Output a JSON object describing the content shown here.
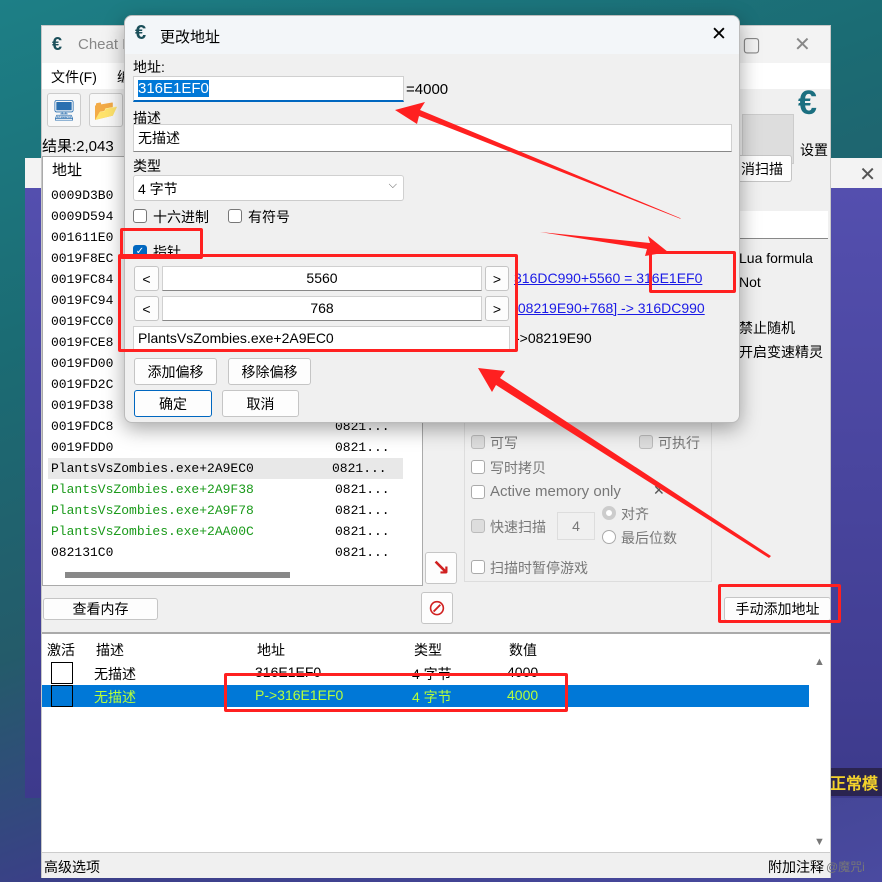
{
  "game_window": {
    "banner": "长正常模"
  },
  "main_window": {
    "title": "Cheat E",
    "menu": [
      "文件(F)",
      "编"
    ],
    "results_label": "结果:2,043",
    "settings_label": "设置",
    "cancel_scan_label": "消扫描",
    "list": {
      "header": "地址",
      "rows": [
        {
          "address": "0009D3B0",
          "value": ""
        },
        {
          "address": "0009D594",
          "value": ""
        },
        {
          "address": "001611E0",
          "value": ""
        },
        {
          "address": "0019F8EC",
          "value": ""
        },
        {
          "address": "0019FC84",
          "value": ""
        },
        {
          "address": "0019FC94",
          "value": ""
        },
        {
          "address": "0019FCC0",
          "value": ""
        },
        {
          "address": "0019FCE8",
          "value": ""
        },
        {
          "address": "0019FD00",
          "value": ""
        },
        {
          "address": "0019FD2C",
          "value": ""
        },
        {
          "address": "0019FD38",
          "value": ""
        },
        {
          "address": "0019FDC8",
          "value": "0821..."
        },
        {
          "address": "0019FDD0",
          "value": "0821..."
        },
        {
          "address": "PlantsVsZombies.exe+2A9EC0",
          "value": "0821..."
        },
        {
          "address": "PlantsVsZombies.exe+2A9F38",
          "value": "0821..."
        },
        {
          "address": "PlantsVsZombies.exe+2A9F78",
          "value": "0821..."
        },
        {
          "address": "PlantsVsZombies.exe+2AA00C",
          "value": "0821..."
        },
        {
          "address": "082131C0",
          "value": "0821..."
        }
      ]
    },
    "scan_options": {
      "lua_formula": "Lua formula",
      "not": "Not",
      "no_random": "禁止随机",
      "speedhack": "开启变速精灵",
      "writable": "可写",
      "executable": "可执行",
      "copy_on_write": "写时拷贝",
      "active_memory_only": "Active memory only",
      "fast_scan": "快速扫描",
      "fast_scan_value": "4",
      "align": "对齐",
      "last_digits": "最后位数",
      "pause_game": "扫描时暂停游戏"
    },
    "view_memory_label": "查看内存",
    "add_address_manually_label": "手动添加地址",
    "table": {
      "headers": [
        "激活",
        "描述",
        "地址",
        "类型",
        "数值"
      ],
      "rows": [
        {
          "active": false,
          "description": "无描述",
          "address": "316E1EF0",
          "type": "4 字节",
          "value": "4000",
          "selected": false
        },
        {
          "active": false,
          "description": "无描述",
          "address": "P->316E1EF0",
          "type": "4 字节",
          "value": "4000",
          "selected": true
        }
      ]
    },
    "status": {
      "advanced": "高级选项",
      "comments": "附加注释",
      "watermark": "@魔咒i"
    }
  },
  "dialog": {
    "title": "更改地址",
    "address_label": "地址:",
    "address_value": "316E1EF0",
    "address_result": "=4000",
    "description_label": "描述",
    "description_value": "无描述",
    "type_label": "类型",
    "type_value": "4 字节",
    "hex_label": "十六进制",
    "signed_label": "有符号",
    "pointer_label": "指针",
    "pointer_checked": true,
    "offsets": [
      {
        "value": "5560",
        "result": "316DC990+5560 = 316E1EF0"
      },
      {
        "value": "768",
        "result": "[08219E90+768] -> 316DC990"
      }
    ],
    "base_address": "PlantsVsZombies.exe+2A9EC0",
    "base_result": "->08219E90",
    "prev_label": "<",
    "next_label": ">",
    "add_offset_label": "添加偏移",
    "remove_offset_label": "移除偏移",
    "ok_label": "确定",
    "cancel_label": "取消"
  },
  "colors": {
    "accent": "#0078d7",
    "annotation": "#ff2020",
    "selected_text": "#b6ff3a",
    "link": "#1a1ae6",
    "green_entry": "#1a9a1a"
  }
}
